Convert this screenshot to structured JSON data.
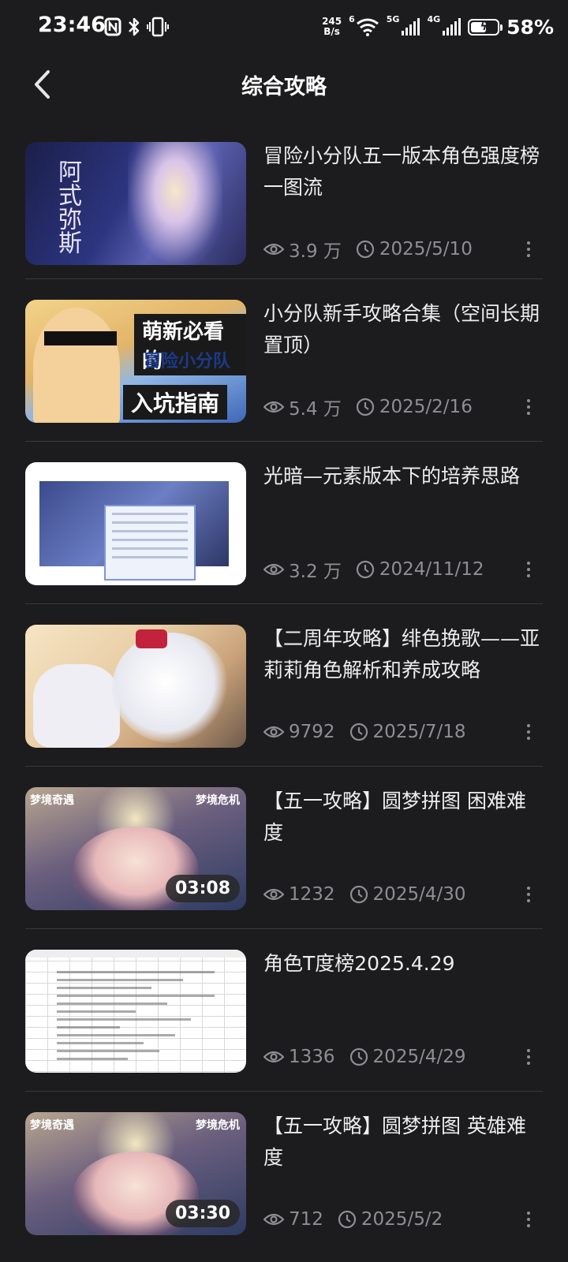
{
  "status_bar": {
    "time": "23:46",
    "net_speed_value": "245",
    "net_speed_unit": "B/s",
    "wifi_tag": "6",
    "sim1_tag": "5G",
    "sim2_tag": "4G",
    "battery_level": 0.58,
    "battery_percent": "58%",
    "icons": [
      "nfc-icon",
      "bluetooth-icon",
      "vibrate-icon",
      "wifi-icon",
      "signal-icon",
      "battery-charging-icon"
    ]
  },
  "header": {
    "title": "综合攻略",
    "back_icon": "chevron-left-icon"
  },
  "items": [
    {
      "title": "冒险小分队五一版本角色强度榜一图流",
      "views": "3.9 万",
      "date": "2025/5/10",
      "duration": ""
    },
    {
      "title": "小分队新手攻略合集（空间长期置顶）",
      "views": "5.4 万",
      "date": "2025/2/16",
      "duration": ""
    },
    {
      "title": "光暗—元素版本下的培养思路",
      "views": "3.2 万",
      "date": "2024/11/12",
      "duration": ""
    },
    {
      "title": "【二周年攻略】绯色挽歌——亚莉莉角色解析和养成攻略",
      "views": "9792",
      "date": "2025/7/18",
      "duration": ""
    },
    {
      "title": "【五一攻略】圆梦拼图 困难难度",
      "views": "1232",
      "date": "2025/4/30",
      "duration": "03:08"
    },
    {
      "title": "角色T度榜2025.4.29",
      "views": "1336",
      "date": "2025/4/29",
      "duration": ""
    },
    {
      "title": "【五一攻略】圆梦拼图 英雄难度",
      "views": "712",
      "date": "2025/5/2",
      "duration": "03:30"
    }
  ],
  "thumbnail_text": {
    "t1": "阿式弥斯",
    "t2_top": "萌新必看的",
    "t2_mid": "冒险小分队",
    "t2_bottom": "入坑指南",
    "t5_left": "梦境奇遇",
    "t5_right": "梦境危机",
    "t7_left": "梦境奇遇",
    "t7_right": "梦境危机"
  },
  "colors": {
    "background": "#1c1c1e",
    "text_primary": "#ececec",
    "text_secondary": "#8e8e93",
    "divider": "#3a3a3c"
  }
}
